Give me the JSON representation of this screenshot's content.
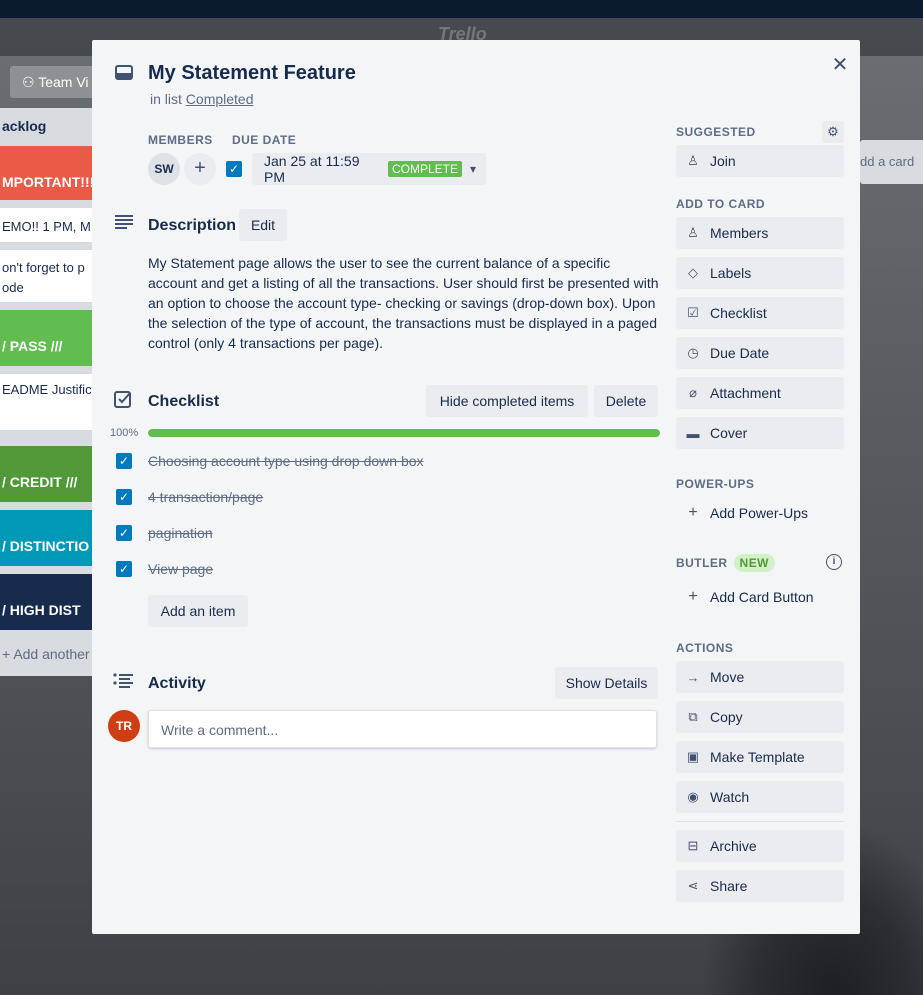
{
  "background": {
    "logo": "Trello",
    "team_button": "Team Vi",
    "list_title": "acklog",
    "cards": [
      "MPORTANT!!!",
      "EMO!! 1 PM, M",
      "on't forget to p",
      "ode",
      "/ PASS ///",
      "EADME Justifica",
      "/ CREDIT ///",
      "/ DISTINCTIO",
      "/ HIGH DIST"
    ],
    "add_another": "Add another",
    "right_list_text": "dd a card"
  },
  "card": {
    "title": "My Statement Feature",
    "in_list_prefix": "in list",
    "list_name": "Completed",
    "members_label": "Members",
    "member_initials": "SW",
    "add_member": "+",
    "due_date_label": "Due Date",
    "due_date_value": "Jan 25 at 11:59 PM",
    "due_status": "COMPLETE",
    "description_title": "Description",
    "edit_label": "Edit",
    "description": "My Statement page allows the user to see the current balance of a specific account and get a listing of all the transactions. User should first be presented with an option to choose the account type- checking or savings (drop-down box). Upon the selection of the type of account, the transactions must be displayed in a paged control (only 4 transactions per page).",
    "checklist_title": "Checklist",
    "hide_completed": "Hide completed items",
    "delete_label": "Delete",
    "progress_text": "100%",
    "progress": 1.0,
    "checklist_items": [
      "Choosing account type using drop down box",
      "4 transaction/page",
      "pagination",
      "View page"
    ],
    "add_item": "Add an item",
    "activity_title": "Activity",
    "show_details": "Show Details",
    "comment_placeholder": "Write a comment...",
    "user_initials": "TR"
  },
  "sidebar": {
    "suggested_label": "Suggested",
    "join": "Join",
    "add_to_card_label": "Add to card",
    "add_to_card": [
      "Members",
      "Labels",
      "Checklist",
      "Due Date",
      "Attachment",
      "Cover"
    ],
    "powerups_label": "Power-Ups",
    "add_powerups": "Add Power-Ups",
    "butler_label": "Butler",
    "butler_badge": "NEW",
    "add_card_button": "Add Card Button",
    "actions_label": "Actions",
    "actions": [
      "Move",
      "Copy",
      "Make Template",
      "Watch"
    ],
    "archive": "Archive",
    "share": "Share"
  },
  "colors": {
    "accent": "#0079bf",
    "complete_green": "#61bd4f",
    "avatar_tr": "#cf3d14"
  }
}
